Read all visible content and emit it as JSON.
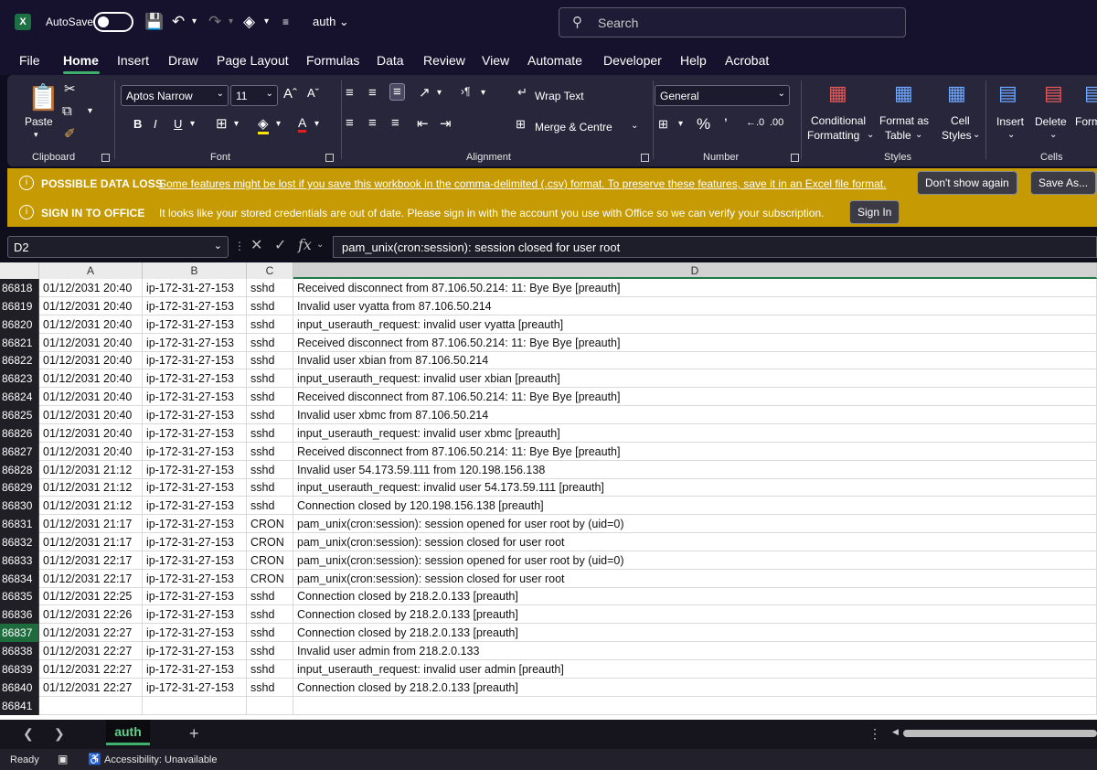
{
  "titlebar": {
    "autosave_label": "AutoSave",
    "filename": "auth",
    "search_placeholder": "Search"
  },
  "menu": [
    "File",
    "Home",
    "Insert",
    "Draw",
    "Page Layout",
    "Formulas",
    "Data",
    "Review",
    "View",
    "Automate",
    "Developer",
    "Help",
    "Acrobat"
  ],
  "ribbon": {
    "clipboard": {
      "paste": "Paste",
      "label": "Clipboard"
    },
    "font": {
      "name": "Aptos Narrow",
      "size": "11",
      "label": "Font",
      "bold": "B",
      "italic": "I",
      "underline": "U"
    },
    "alignment": {
      "wrap": "Wrap Text",
      "merge": "Merge & Centre",
      "label": "Alignment"
    },
    "number": {
      "format": "General",
      "label": "Number"
    },
    "styles": {
      "conditional_1": "Conditional",
      "conditional_2": "Formatting",
      "table_1": "Format as",
      "table_2": "Table",
      "cell_1": "Cell",
      "cell_2": "Styles",
      "label": "Styles"
    },
    "cells": {
      "insert": "Insert",
      "delete": "Delete",
      "format": "Form",
      "label": "Cells"
    }
  },
  "messages": {
    "data_loss_title": "POSSIBLE DATA LOSS",
    "data_loss_text": "Some features might be lost if you save this workbook in the comma-delimited (.csv) format. To preserve these features, save it in an Excel file format.",
    "dont_show": "Don't show again",
    "save_as": "Save As...",
    "signin_title": "SIGN IN TO OFFICE",
    "signin_text": "It looks like your stored credentials are out of date. Please sign in with the account you use with Office so we can verify your subscription.",
    "signin_button": "Sign In"
  },
  "formula_bar": {
    "name_box": "D2",
    "fx": "fx",
    "formula": "pam_unix(cron:session): session closed for user root"
  },
  "columns": [
    "A",
    "B",
    "C",
    "D"
  ],
  "rows": [
    {
      "n": "86818",
      "a": "01/12/2031 20:40",
      "b": "ip-172-31-27-153",
      "c": "sshd",
      "d": "Received disconnect from 87.106.50.214: 11: Bye Bye [preauth]"
    },
    {
      "n": "86819",
      "a": "01/12/2031 20:40",
      "b": "ip-172-31-27-153",
      "c": "sshd",
      "d": "Invalid user vyatta from 87.106.50.214"
    },
    {
      "n": "86820",
      "a": "01/12/2031 20:40",
      "b": "ip-172-31-27-153",
      "c": "sshd",
      "d": "input_userauth_request: invalid user vyatta [preauth]"
    },
    {
      "n": "86821",
      "a": "01/12/2031 20:40",
      "b": "ip-172-31-27-153",
      "c": "sshd",
      "d": "Received disconnect from 87.106.50.214: 11: Bye Bye [preauth]"
    },
    {
      "n": "86822",
      "a": "01/12/2031 20:40",
      "b": "ip-172-31-27-153",
      "c": "sshd",
      "d": "Invalid user xbian from 87.106.50.214"
    },
    {
      "n": "86823",
      "a": "01/12/2031 20:40",
      "b": "ip-172-31-27-153",
      "c": "sshd",
      "d": "input_userauth_request: invalid user xbian [preauth]"
    },
    {
      "n": "86824",
      "a": "01/12/2031 20:40",
      "b": "ip-172-31-27-153",
      "c": "sshd",
      "d": "Received disconnect from 87.106.50.214: 11: Bye Bye [preauth]"
    },
    {
      "n": "86825",
      "a": "01/12/2031 20:40",
      "b": "ip-172-31-27-153",
      "c": "sshd",
      "d": "Invalid user xbmc from 87.106.50.214"
    },
    {
      "n": "86826",
      "a": "01/12/2031 20:40",
      "b": "ip-172-31-27-153",
      "c": "sshd",
      "d": "input_userauth_request: invalid user xbmc [preauth]"
    },
    {
      "n": "86827",
      "a": "01/12/2031 20:40",
      "b": "ip-172-31-27-153",
      "c": "sshd",
      "d": "Received disconnect from 87.106.50.214: 11: Bye Bye [preauth]"
    },
    {
      "n": "86828",
      "a": "01/12/2031 21:12",
      "b": "ip-172-31-27-153",
      "c": "sshd",
      "d": "Invalid user 54.173.59.111 from 120.198.156.138"
    },
    {
      "n": "86829",
      "a": "01/12/2031 21:12",
      "b": "ip-172-31-27-153",
      "c": "sshd",
      "d": "input_userauth_request: invalid user 54.173.59.111 [preauth]"
    },
    {
      "n": "86830",
      "a": "01/12/2031 21:12",
      "b": "ip-172-31-27-153",
      "c": "sshd",
      "d": "Connection closed by 120.198.156.138 [preauth]"
    },
    {
      "n": "86831",
      "a": "01/12/2031 21:17",
      "b": "ip-172-31-27-153",
      "c": "CRON",
      "d": "pam_unix(cron:session): session opened for user root by (uid=0)"
    },
    {
      "n": "86832",
      "a": "01/12/2031 21:17",
      "b": "ip-172-31-27-153",
      "c": "CRON",
      "d": "pam_unix(cron:session): session closed for user root"
    },
    {
      "n": "86833",
      "a": "01/12/2031 22:17",
      "b": "ip-172-31-27-153",
      "c": "CRON",
      "d": "pam_unix(cron:session): session opened for user root by (uid=0)"
    },
    {
      "n": "86834",
      "a": "01/12/2031 22:17",
      "b": "ip-172-31-27-153",
      "c": "CRON",
      "d": "pam_unix(cron:session): session closed for user root"
    },
    {
      "n": "86835",
      "a": "01/12/2031 22:25",
      "b": "ip-172-31-27-153",
      "c": "sshd",
      "d": "Connection closed by 218.2.0.133 [preauth]"
    },
    {
      "n": "86836",
      "a": "01/12/2031 22:26",
      "b": "ip-172-31-27-153",
      "c": "sshd",
      "d": "Connection closed by 218.2.0.133 [preauth]"
    },
    {
      "n": "86837",
      "a": "01/12/2031 22:27",
      "b": "ip-172-31-27-153",
      "c": "sshd",
      "d": "Connection closed by 218.2.0.133 [preauth]"
    },
    {
      "n": "86838",
      "a": "01/12/2031 22:27",
      "b": "ip-172-31-27-153",
      "c": "sshd",
      "d": "Invalid user admin from 218.2.0.133"
    },
    {
      "n": "86839",
      "a": "01/12/2031 22:27",
      "b": "ip-172-31-27-153",
      "c": "sshd",
      "d": "input_userauth_request: invalid user admin [preauth]"
    },
    {
      "n": "86840",
      "a": "01/12/2031 22:27",
      "b": "ip-172-31-27-153",
      "c": "sshd",
      "d": "Connection closed by 218.2.0.133 [preauth]"
    },
    {
      "n": "86841",
      "a": "",
      "b": "",
      "c": "",
      "d": ""
    }
  ],
  "selected_row": "86837",
  "sheet": {
    "tab": "auth"
  },
  "status": {
    "ready": "Ready",
    "accessibility": "Accessibility: Unavailable"
  },
  "colors": {
    "accent": "#3fb06b",
    "warning_bar": "#c69a02",
    "selected_row_header": "#1e6b3d"
  }
}
